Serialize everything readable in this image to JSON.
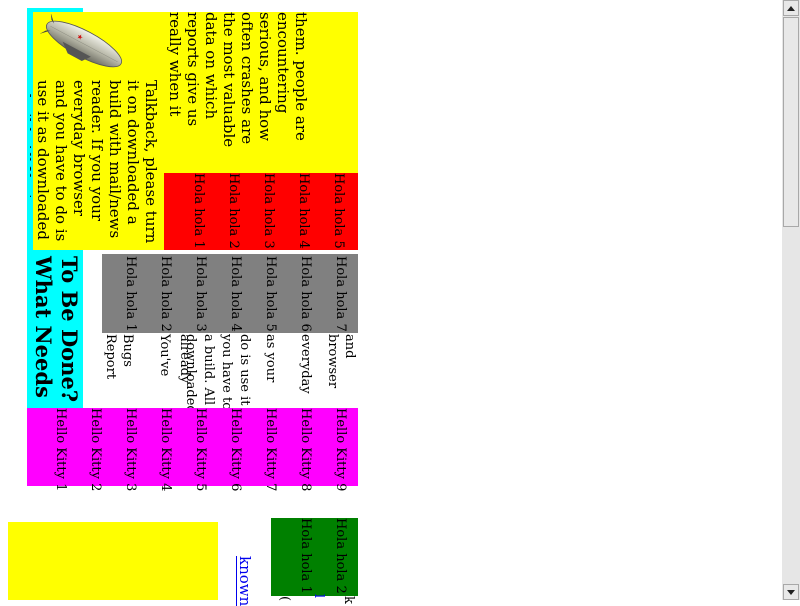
{
  "colors": {
    "cyan": "#00ffff",
    "yellow": "#ffff00",
    "red": "#ff0000",
    "gray": "#808080",
    "magenta": "#ff00ff",
    "green": "#008000",
    "link": "#0000ee"
  },
  "icons": {
    "zeppelin": "zeppelin-image",
    "scroll_up": "triangle-up",
    "scroll_down": "triangle-down"
  },
  "intro_text": "them. people are encountering serious, and how often crashes are the most valuable data on which reports give us really when it asks. Talkback",
  "talkback_text": "Talkback, please turn it on downloaded a build with mail/news reader. If you your everyday browser and you have to do is use it as downloaded a build. All You've already",
  "red_cells": [
    "Hola hola 5",
    "Hola hola 4",
    "Hola hola 3",
    "Hola hola 2",
    "Hola hola 1"
  ],
  "heading": {
    "line1": "To Be Done?",
    "line2": "What Needs"
  },
  "gray_cells": [
    "Hola hola 7",
    "Hola hola 6",
    "Hola hola 5",
    "Hola hola 4",
    "Hola hola 3",
    "Hola hola 2",
    "Hola hola 1"
  ],
  "white_fragments": [
    "and browser",
    "everyday",
    "as your",
    "do is use it",
    "you have to",
    "a build. All",
    "downloaded",
    "already",
    "You've",
    "Bugs Report"
  ],
  "magenta_cells": [
    "Hello Kitty 9",
    "Hello Kitty 8",
    "Hello Kitty 7",
    "Hello Kitty 6",
    "Hello Kitty 5",
    "Hello Kitty 4",
    "Hello Kitty 3",
    "Hello Kitty 2",
    "Hello Kitty 1"
  ],
  "green_cells": [
    "Hola hola 2",
    "Hola hola 1"
  ],
  "link_text": "known",
  "edge_fragments": [
    "k",
    "l",
    "("
  ]
}
